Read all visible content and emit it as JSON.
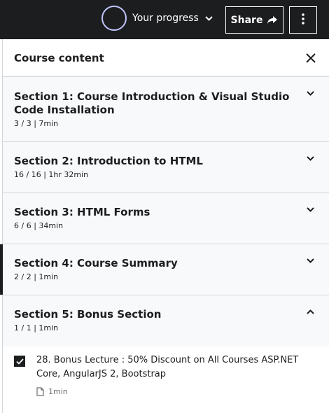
{
  "topbar": {
    "progress_label": "Your progress",
    "share_label": "Share"
  },
  "panel": {
    "title": "Course content"
  },
  "sections": [
    {
      "title": "Section 1: Course Introduction & Visual Studio Code Installation",
      "meta": "3 / 3 | 7min",
      "expanded": false
    },
    {
      "title": "Section 2: Introduction to HTML",
      "meta": "16 / 16 | 1hr 32min",
      "expanded": false
    },
    {
      "title": "Section 3: HTML Forms",
      "meta": "6 / 6 | 34min",
      "expanded": false
    },
    {
      "title": "Section 4: Course Summary",
      "meta": "2 / 2 | 1min",
      "expanded": false
    },
    {
      "title": "Section 5: Bonus Section",
      "meta": "1 / 1 | 1min",
      "expanded": true
    }
  ],
  "lecture": {
    "title": "28. Bonus Lecture : 50% Discount on All Courses ASP.NET Core, AngularJS 2, Bootstrap",
    "duration": "1min",
    "completed": true
  },
  "colors": {
    "topbar_bg": "#1c1d1f",
    "progress_ring": "#c0c4fc",
    "section_bg": "#f7f9fa",
    "border": "#d1d7dc"
  }
}
